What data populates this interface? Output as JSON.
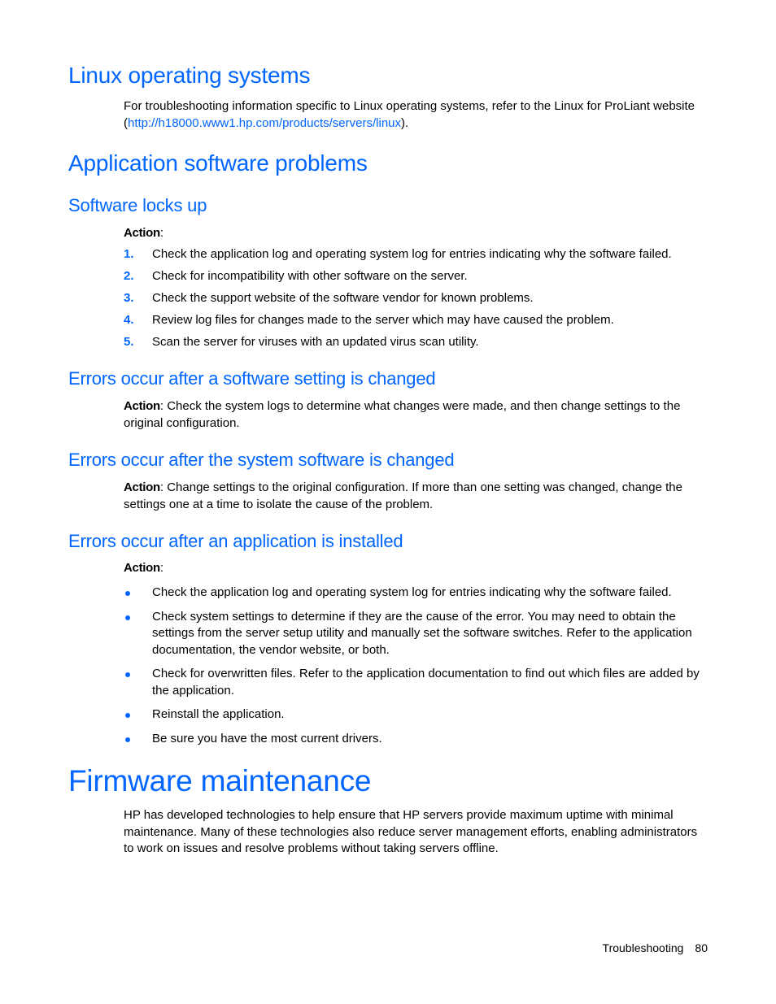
{
  "sections": {
    "linux": {
      "title": "Linux operating systems",
      "text_before": "For troubleshooting information specific to Linux operating systems, refer to the Linux for ProLiant website (",
      "link": "http://h18000.www1.hp.com/products/servers/linux",
      "text_after": ")."
    },
    "app_problems": {
      "title": "Application software problems"
    },
    "software_locks": {
      "title": "Software locks up",
      "action_label": "Action",
      "steps": [
        {
          "num": "1.",
          "text": "Check the application log and operating system log for entries indicating why the software failed."
        },
        {
          "num": "2.",
          "text": "Check for incompatibility with other software on the server."
        },
        {
          "num": "3.",
          "text": "Check the support website of the software vendor for known problems."
        },
        {
          "num": "4.",
          "text": "Review log files for changes made to the server which may have caused the problem."
        },
        {
          "num": "5.",
          "text": "Scan the server for viruses with an updated virus scan utility."
        }
      ]
    },
    "setting_changed": {
      "title": "Errors occur after a software setting is changed",
      "action_label": "Action",
      "text": ": Check the system logs to determine what changes were made, and then change settings to the original configuration."
    },
    "system_software_changed": {
      "title": "Errors occur after the system software is changed",
      "action_label": "Action",
      "text": ": Change settings to the original configuration. If more than one setting was changed, change the settings one at a time to isolate the cause of the problem."
    },
    "app_installed": {
      "title": "Errors occur after an application is installed",
      "action_label": "Action",
      "bullets": [
        "Check the application log and operating system log for entries indicating why the software failed.",
        "Check system settings to determine if they are the cause of the error. You may need to obtain the settings from the server setup utility and manually set the software switches. Refer to the application documentation, the vendor website, or both.",
        "Check for overwritten files. Refer to the application documentation to find out which files are added by the application.",
        "Reinstall the application.",
        "Be sure you have the most current drivers."
      ]
    },
    "firmware": {
      "title": "Firmware maintenance",
      "text": "HP has developed technologies to help ensure that HP servers provide maximum uptime with minimal maintenance. Many of these technologies also reduce server management efforts, enabling administrators to work on issues and resolve problems without taking servers offline."
    }
  },
  "footer": {
    "section": "Troubleshooting",
    "page": "80"
  }
}
